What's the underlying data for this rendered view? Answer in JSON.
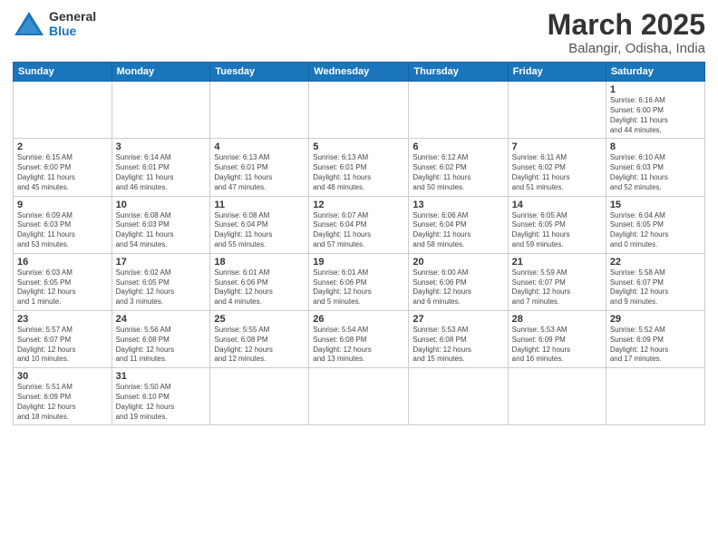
{
  "logo": {
    "line1": "General",
    "line2": "Blue"
  },
  "title": "March 2025",
  "subtitle": "Balangir, Odisha, India",
  "days_of_week": [
    "Sunday",
    "Monday",
    "Tuesday",
    "Wednesday",
    "Thursday",
    "Friday",
    "Saturday"
  ],
  "weeks": [
    [
      {
        "day": "",
        "info": ""
      },
      {
        "day": "",
        "info": ""
      },
      {
        "day": "",
        "info": ""
      },
      {
        "day": "",
        "info": ""
      },
      {
        "day": "",
        "info": ""
      },
      {
        "day": "",
        "info": ""
      },
      {
        "day": "1",
        "info": "Sunrise: 6:16 AM\nSunset: 6:00 PM\nDaylight: 11 hours\nand 44 minutes."
      }
    ],
    [
      {
        "day": "2",
        "info": "Sunrise: 6:15 AM\nSunset: 6:00 PM\nDaylight: 11 hours\nand 45 minutes."
      },
      {
        "day": "3",
        "info": "Sunrise: 6:14 AM\nSunset: 6:01 PM\nDaylight: 11 hours\nand 46 minutes."
      },
      {
        "day": "4",
        "info": "Sunrise: 6:13 AM\nSunset: 6:01 PM\nDaylight: 11 hours\nand 47 minutes."
      },
      {
        "day": "5",
        "info": "Sunrise: 6:13 AM\nSunset: 6:01 PM\nDaylight: 11 hours\nand 48 minutes."
      },
      {
        "day": "6",
        "info": "Sunrise: 6:12 AM\nSunset: 6:02 PM\nDaylight: 11 hours\nand 50 minutes."
      },
      {
        "day": "7",
        "info": "Sunrise: 6:11 AM\nSunset: 6:02 PM\nDaylight: 11 hours\nand 51 minutes."
      },
      {
        "day": "8",
        "info": "Sunrise: 6:10 AM\nSunset: 6:03 PM\nDaylight: 11 hours\nand 52 minutes."
      }
    ],
    [
      {
        "day": "9",
        "info": "Sunrise: 6:09 AM\nSunset: 6:03 PM\nDaylight: 11 hours\nand 53 minutes."
      },
      {
        "day": "10",
        "info": "Sunrise: 6:08 AM\nSunset: 6:03 PM\nDaylight: 11 hours\nand 54 minutes."
      },
      {
        "day": "11",
        "info": "Sunrise: 6:08 AM\nSunset: 6:04 PM\nDaylight: 11 hours\nand 55 minutes."
      },
      {
        "day": "12",
        "info": "Sunrise: 6:07 AM\nSunset: 6:04 PM\nDaylight: 11 hours\nand 57 minutes."
      },
      {
        "day": "13",
        "info": "Sunrise: 6:06 AM\nSunset: 6:04 PM\nDaylight: 11 hours\nand 58 minutes."
      },
      {
        "day": "14",
        "info": "Sunrise: 6:05 AM\nSunset: 6:05 PM\nDaylight: 11 hours\nand 59 minutes."
      },
      {
        "day": "15",
        "info": "Sunrise: 6:04 AM\nSunset: 6:05 PM\nDaylight: 12 hours\nand 0 minutes."
      }
    ],
    [
      {
        "day": "16",
        "info": "Sunrise: 6:03 AM\nSunset: 6:05 PM\nDaylight: 12 hours\nand 1 minute."
      },
      {
        "day": "17",
        "info": "Sunrise: 6:02 AM\nSunset: 6:05 PM\nDaylight: 12 hours\nand 3 minutes."
      },
      {
        "day": "18",
        "info": "Sunrise: 6:01 AM\nSunset: 6:06 PM\nDaylight: 12 hours\nand 4 minutes."
      },
      {
        "day": "19",
        "info": "Sunrise: 6:01 AM\nSunset: 6:06 PM\nDaylight: 12 hours\nand 5 minutes."
      },
      {
        "day": "20",
        "info": "Sunrise: 6:00 AM\nSunset: 6:06 PM\nDaylight: 12 hours\nand 6 minutes."
      },
      {
        "day": "21",
        "info": "Sunrise: 5:59 AM\nSunset: 6:07 PM\nDaylight: 12 hours\nand 7 minutes."
      },
      {
        "day": "22",
        "info": "Sunrise: 5:58 AM\nSunset: 6:07 PM\nDaylight: 12 hours\nand 9 minutes."
      }
    ],
    [
      {
        "day": "23",
        "info": "Sunrise: 5:57 AM\nSunset: 6:07 PM\nDaylight: 12 hours\nand 10 minutes."
      },
      {
        "day": "24",
        "info": "Sunrise: 5:56 AM\nSunset: 6:08 PM\nDaylight: 12 hours\nand 11 minutes."
      },
      {
        "day": "25",
        "info": "Sunrise: 5:55 AM\nSunset: 6:08 PM\nDaylight: 12 hours\nand 12 minutes."
      },
      {
        "day": "26",
        "info": "Sunrise: 5:54 AM\nSunset: 6:08 PM\nDaylight: 12 hours\nand 13 minutes."
      },
      {
        "day": "27",
        "info": "Sunrise: 5:53 AM\nSunset: 6:08 PM\nDaylight: 12 hours\nand 15 minutes."
      },
      {
        "day": "28",
        "info": "Sunrise: 5:53 AM\nSunset: 6:09 PM\nDaylight: 12 hours\nand 16 minutes."
      },
      {
        "day": "29",
        "info": "Sunrise: 5:52 AM\nSunset: 6:09 PM\nDaylight: 12 hours\nand 17 minutes."
      }
    ],
    [
      {
        "day": "30",
        "info": "Sunrise: 5:51 AM\nSunset: 6:09 PM\nDaylight: 12 hours\nand 18 minutes."
      },
      {
        "day": "31",
        "info": "Sunrise: 5:50 AM\nSunset: 6:10 PM\nDaylight: 12 hours\nand 19 minutes."
      },
      {
        "day": "",
        "info": ""
      },
      {
        "day": "",
        "info": ""
      },
      {
        "day": "",
        "info": ""
      },
      {
        "day": "",
        "info": ""
      },
      {
        "day": "",
        "info": ""
      }
    ]
  ]
}
